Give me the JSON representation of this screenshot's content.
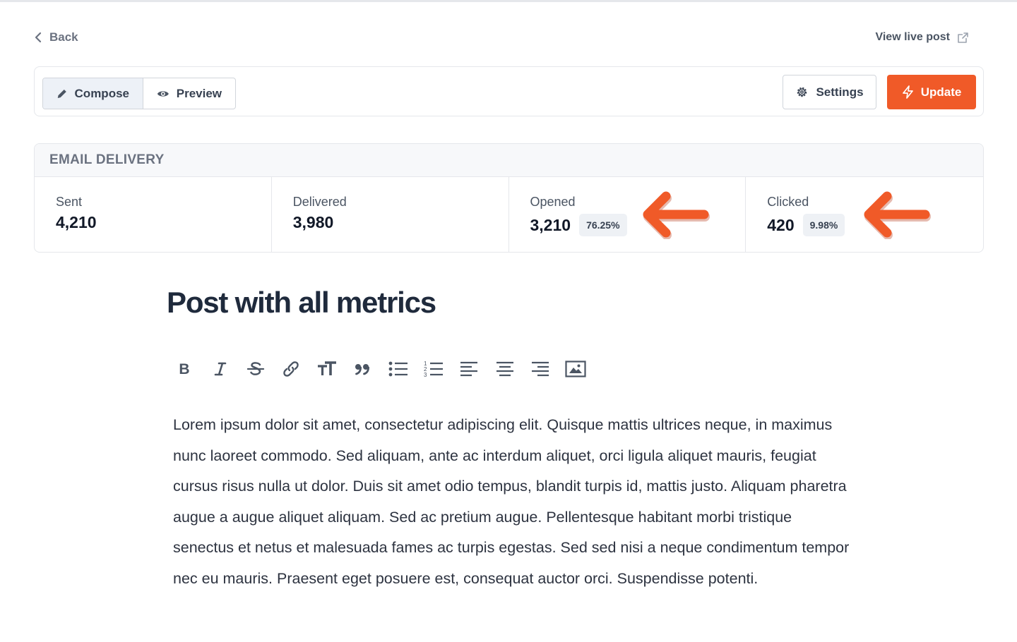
{
  "nav": {
    "back_label": "Back",
    "view_live_label": "View live post"
  },
  "toolbar": {
    "tabs": [
      {
        "label": "Compose",
        "active": true
      },
      {
        "label": "Preview",
        "active": false
      }
    ],
    "settings_label": "Settings",
    "update_label": "Update"
  },
  "email_delivery": {
    "heading": "EMAIL DELIVERY",
    "stats": [
      {
        "label": "Sent",
        "value": "4,210"
      },
      {
        "label": "Delivered",
        "value": "3,980"
      },
      {
        "label": "Opened",
        "value": "3,210",
        "percent": "76.25%"
      },
      {
        "label": "Clicked",
        "value": "420",
        "percent": "9.98%"
      }
    ]
  },
  "post": {
    "title": "Post with all metrics",
    "body": "Lorem ipsum dolor sit amet, consectetur adipiscing elit. Quisque mattis ultrices neque, in maximus nunc laoreet commodo. Sed aliquam, ante ac interdum aliquet, orci ligula aliquet mauris, feugiat cursus risus nulla ut dolor. Duis sit amet odio tempus, blandit turpis id, mattis justo. Aliquam pharetra augue a augue aliquet aliquam. Sed ac pretium augue. Pellentesque habitant morbi tristique senectus et netus et malesuada fames ac turpis egestas. Sed sed nisi a neque condimentum tempor nec eu mauris. Praesent eget posuere est, consequat auctor orci. Suspendisse potenti."
  },
  "formatting_icons": [
    "bold-icon",
    "italic-icon",
    "strikethrough-icon",
    "link-icon",
    "text-size-icon",
    "quote-icon",
    "bullet-list-icon",
    "numbered-list-icon",
    "align-left-icon",
    "align-center-icon",
    "align-right-icon",
    "image-icon"
  ],
  "colors": {
    "accent": "#f05a28",
    "annotation_arrow": "#f05a28",
    "text_primary": "#1f2a3c",
    "muted": "#6b7280"
  }
}
